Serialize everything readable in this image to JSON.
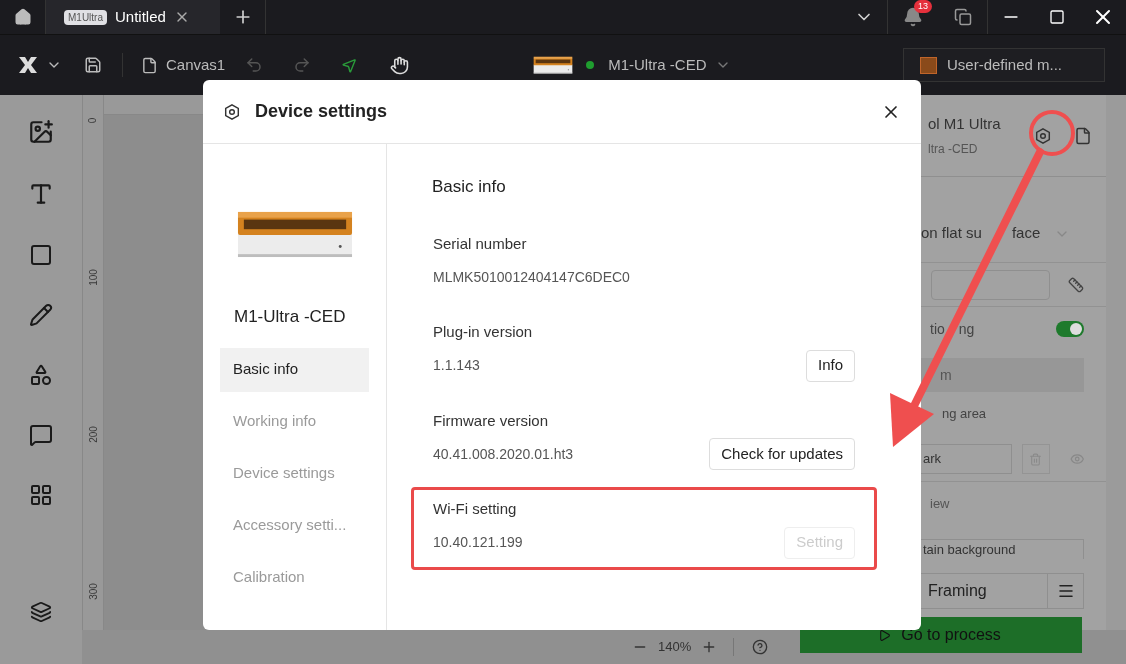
{
  "title_bar": {
    "tabs": [
      {
        "badge": "M1Ultra",
        "title": "Untitled",
        "selected": true
      }
    ],
    "notification_count": "13"
  },
  "toolbar": {
    "document": "Canvas1",
    "device": {
      "name": "M1-Ultra -CED",
      "connected": true
    },
    "material": "User-defined m..."
  },
  "ruler": {
    "marks": [
      "0",
      "100",
      "200",
      "300"
    ]
  },
  "zoom": {
    "value": "140%"
  },
  "right_panel": {
    "device_title": "ol M1 Ultra",
    "device_subtitle": "ltra -CED",
    "surface": "on flat su",
    "surface_end": "face",
    "positioning": {
      "label": "tio",
      "label_end": "ng",
      "on": true
    },
    "row_label": "m",
    "area_label": "ng area",
    "mark_field": "ark",
    "view_label": "iew",
    "background_option": "tain background",
    "framing": "Framing",
    "process_button": "Go to process"
  },
  "dialog": {
    "title": "Device settings",
    "device_name": "M1-Ultra -CED",
    "nav": [
      {
        "label": "Basic info",
        "selected": true
      },
      {
        "label": "Working info",
        "selected": false
      },
      {
        "label": "Device settings",
        "selected": false
      },
      {
        "label": "Accessory setti...",
        "selected": false
      },
      {
        "label": "Calibration",
        "selected": false
      }
    ],
    "section_title": "Basic info",
    "fields": [
      {
        "label": "Serial number",
        "value": "MLMK5010012404147C6DEC0",
        "highlighted": false
      },
      {
        "label": "Plug-in version",
        "value": "1.1.143",
        "button": {
          "label": "Info",
          "disabled": false
        },
        "highlighted": false
      },
      {
        "label": "Firmware version",
        "value": "40.41.008.2020.01.ht3",
        "button": {
          "label": "Check for updates",
          "disabled": false
        },
        "highlighted": false
      },
      {
        "label": "Wi-Fi setting",
        "value": "10.40.121.199",
        "button": {
          "label": "Setting",
          "disabled": true
        },
        "highlighted": true
      }
    ]
  }
}
